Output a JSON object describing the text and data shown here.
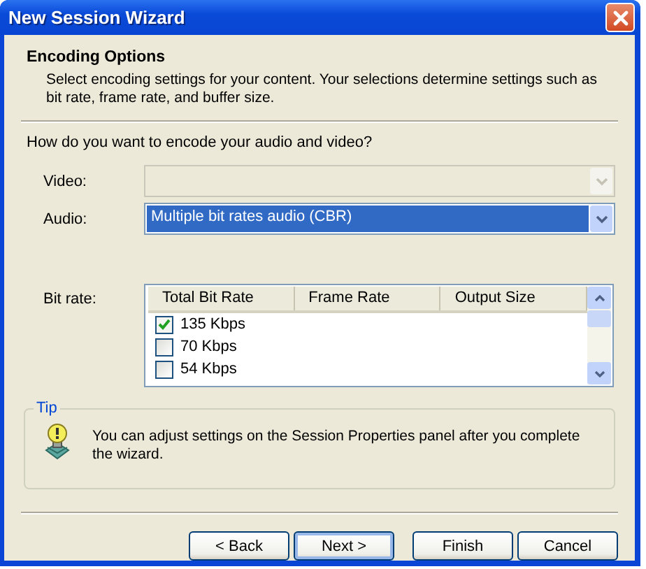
{
  "window": {
    "title": "New Session Wizard"
  },
  "header": {
    "title": "Encoding Options",
    "description": "Select encoding settings for your content. Your selections determine settings such as bit rate, frame rate, and buffer size."
  },
  "question": "How do you want to encode your audio and video?",
  "dropdowns": [
    {
      "label": "Video:",
      "disabled": true
    },
    {
      "label": "Audio:",
      "value": "Multiple bit rates audio (CBR)",
      "disabled": false
    }
  ],
  "bit_rate": {
    "label": "Bit rate:",
    "columns": [
      "Total Bit Rate",
      "Frame Rate",
      "Output Size"
    ],
    "rows": [
      {
        "label": "135 Kbps",
        "checked": true
      },
      {
        "label": "70 Kbps",
        "checked": false
      },
      {
        "label": "54 Kbps",
        "checked": false
      }
    ]
  },
  "tip": {
    "title": "Tip",
    "text": "You can adjust settings on the Session Properties panel after you complete the wizard."
  },
  "buttons": [
    {
      "label": "< Back",
      "default": false
    },
    {
      "label": "Next >",
      "default": true
    },
    {
      "label": "Finish",
      "default": false
    },
    {
      "label": "Cancel",
      "default": false
    }
  ]
}
